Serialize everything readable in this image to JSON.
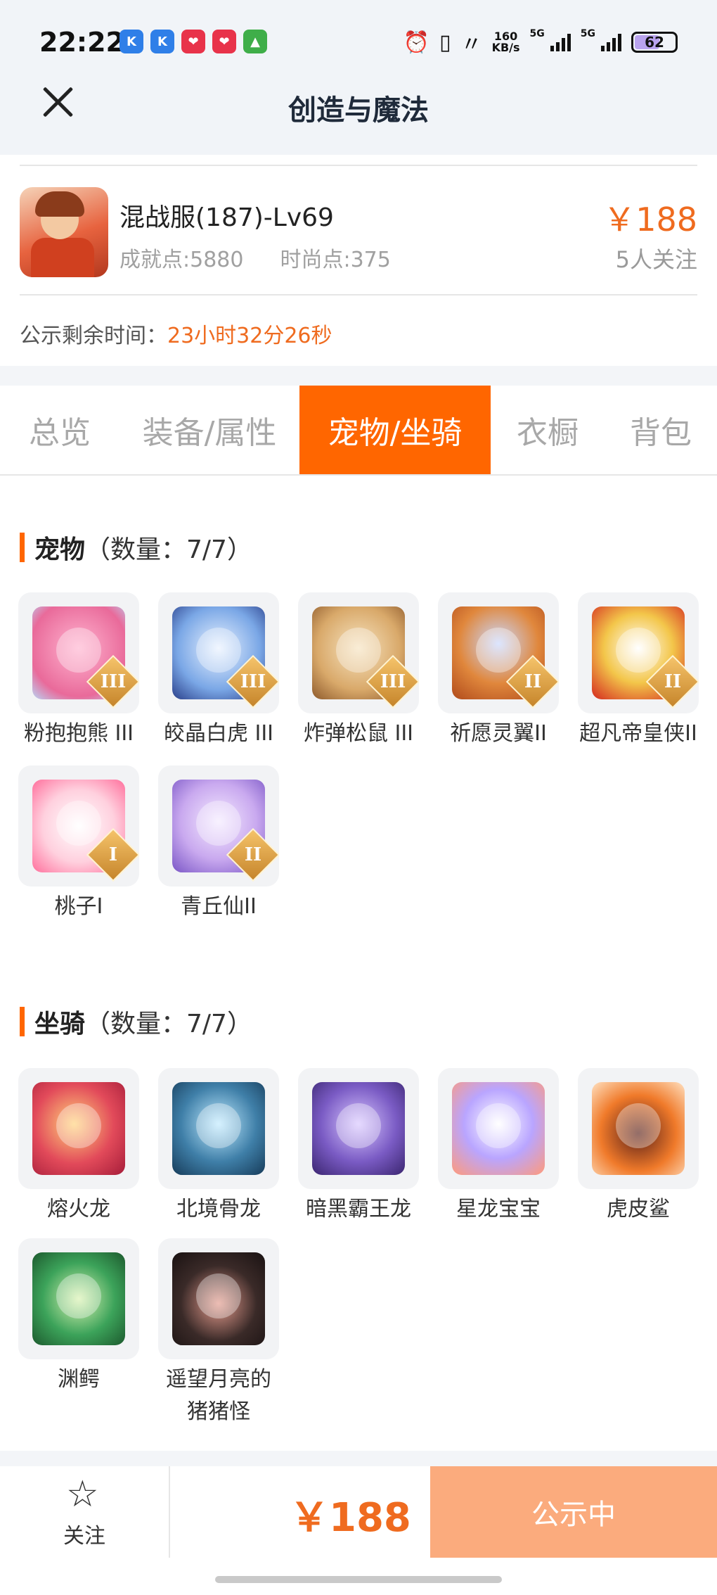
{
  "status_bar": {
    "time": "22:22",
    "speed": "160",
    "speed_unit": "KB/s",
    "net1": "5G",
    "net2": "5G",
    "battery": "62"
  },
  "header": {
    "title": "创造与魔法"
  },
  "item": {
    "name": "混战服(187)-Lv69",
    "achievement": "成就点:5880",
    "fashion": "时尚点:375",
    "price": "￥188",
    "followers": "5人关注"
  },
  "notice": {
    "label": "公示剩余时间：",
    "value": "23小时32分26秒"
  },
  "tabs": [
    "总览",
    "装备/属性",
    "宠物/坐骑",
    "衣橱",
    "背包"
  ],
  "active_tab": 2,
  "pets": {
    "title": "宠物",
    "count": "（数量：7/7）",
    "items": [
      {
        "name": "粉抱抱熊 III",
        "grade": "III"
      },
      {
        "name": "皎晶白虎 III",
        "grade": "III"
      },
      {
        "name": "炸弹松鼠 III",
        "grade": "III"
      },
      {
        "name": "祈愿灵翼II",
        "grade": "II"
      },
      {
        "name": "超凡帝皇侠II",
        "grade": "II"
      },
      {
        "name": "桃子I",
        "grade": "I"
      },
      {
        "name": "青丘仙II",
        "grade": "II"
      }
    ]
  },
  "mounts": {
    "title": "坐骑",
    "count": "（数量：7/7）",
    "items": [
      {
        "name": "熔火龙"
      },
      {
        "name": "北境骨龙"
      },
      {
        "name": "暗黑霸王龙"
      },
      {
        "name": "星龙宝宝"
      },
      {
        "name": "虎皮鲨"
      },
      {
        "name": "渊鳄"
      },
      {
        "name": "遥望月亮的猪猪怪"
      }
    ]
  },
  "footer": {
    "follow_label": "关注",
    "price": "￥188",
    "action_label": "公示中"
  },
  "colors": {
    "accent": "#ff6600",
    "price": "#ef6b1f",
    "action_bg": "#fbab7d"
  }
}
